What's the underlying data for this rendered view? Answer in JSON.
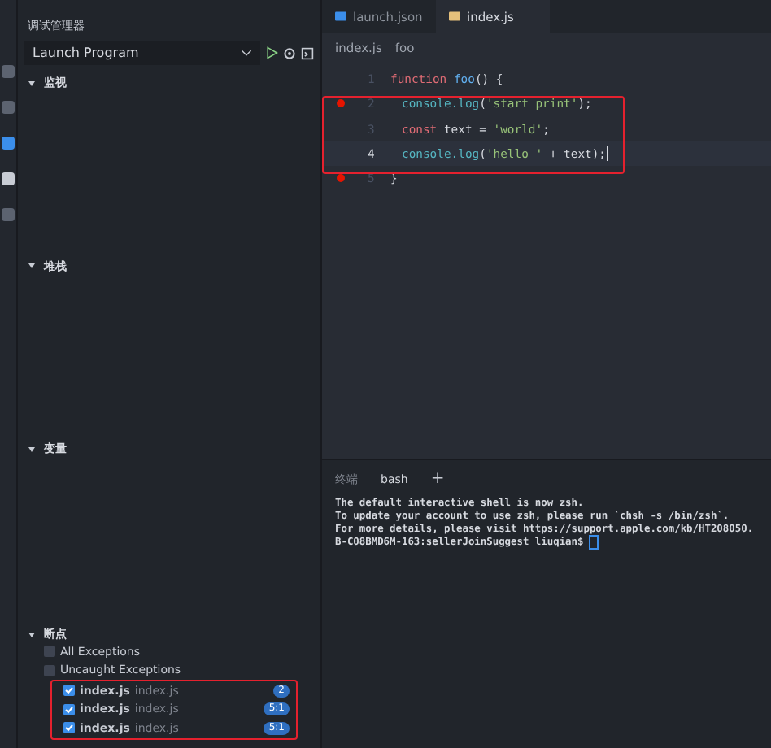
{
  "sidebar": {
    "title": "调试管理器",
    "config": {
      "value": "Launch Program"
    },
    "sections": [
      {
        "label": "监视",
        "expanded": true
      },
      {
        "label": "堆栈",
        "expanded": true
      },
      {
        "label": "变量",
        "expanded": true
      }
    ],
    "breakpoints": {
      "label": "断点",
      "expanded": true,
      "exceptions": [
        {
          "label": "All Exceptions",
          "checked": false
        },
        {
          "label": "Uncaught Exceptions",
          "checked": false
        }
      ],
      "items": [
        {
          "file": "index.js",
          "path": "index.js",
          "line": "2",
          "checked": true
        },
        {
          "file": "index.js",
          "path": "index.js",
          "line": "5:1",
          "checked": true
        },
        {
          "file": "index.js",
          "path": "index.js",
          "line": "5:1",
          "checked": true
        }
      ]
    }
  },
  "editor": {
    "tabs": [
      {
        "label": "launch.json",
        "kind": "json",
        "selected": false
      },
      {
        "label": "index.js",
        "kind": "js",
        "selected": true
      }
    ],
    "breadcrumb": [
      "index.js",
      "foo"
    ],
    "lines": [
      {
        "number": "1",
        "breakpoint": false,
        "current": false,
        "indent": false,
        "tokens": [
          {
            "kind": "keyword",
            "text": "function "
          },
          {
            "kind": "fn",
            "text": "foo"
          },
          {
            "kind": "punct",
            "text": "() {"
          }
        ]
      },
      {
        "number": "2",
        "breakpoint": true,
        "current": false,
        "indent": true,
        "tokens": [
          {
            "kind": "call",
            "text": "console.log"
          },
          {
            "kind": "punct",
            "text": "("
          },
          {
            "kind": "string",
            "text": "'start print'"
          },
          {
            "kind": "punct",
            "text": ");"
          }
        ]
      },
      {
        "number": "3",
        "breakpoint": false,
        "current": false,
        "indent": true,
        "tokens": [
          {
            "kind": "keyword",
            "text": "const"
          },
          {
            "kind": "plain",
            "text": " text = "
          },
          {
            "kind": "string",
            "text": "'world'"
          },
          {
            "kind": "punct",
            "text": ";"
          }
        ]
      },
      {
        "number": "4",
        "breakpoint": false,
        "current": true,
        "indent": true,
        "tokens": [
          {
            "kind": "call",
            "text": "console.log"
          },
          {
            "kind": "punct",
            "text": "("
          },
          {
            "kind": "string",
            "text": "'hello '"
          },
          {
            "kind": "plain",
            "text": " + text"
          },
          {
            "kind": "punct",
            "text": ");"
          }
        ]
      },
      {
        "number": "5",
        "breakpoint": true,
        "current": false,
        "indent": false,
        "tokens": [
          {
            "kind": "punct",
            "text": "}"
          }
        ]
      }
    ]
  },
  "terminal": {
    "tabs": [
      {
        "label": "终端",
        "selected": false
      },
      {
        "label": "bash",
        "selected": true
      }
    ],
    "add": "+",
    "lines": [
      "The default interactive shell is now zsh.",
      "To update your account to use zsh, please run `chsh -s /bin/zsh`.",
      "For more details, please visit https://support.apple.com/kb/HT208050.",
      "B-C08BMD6M-163:sellerJoinSuggest liuqian$"
    ]
  }
}
